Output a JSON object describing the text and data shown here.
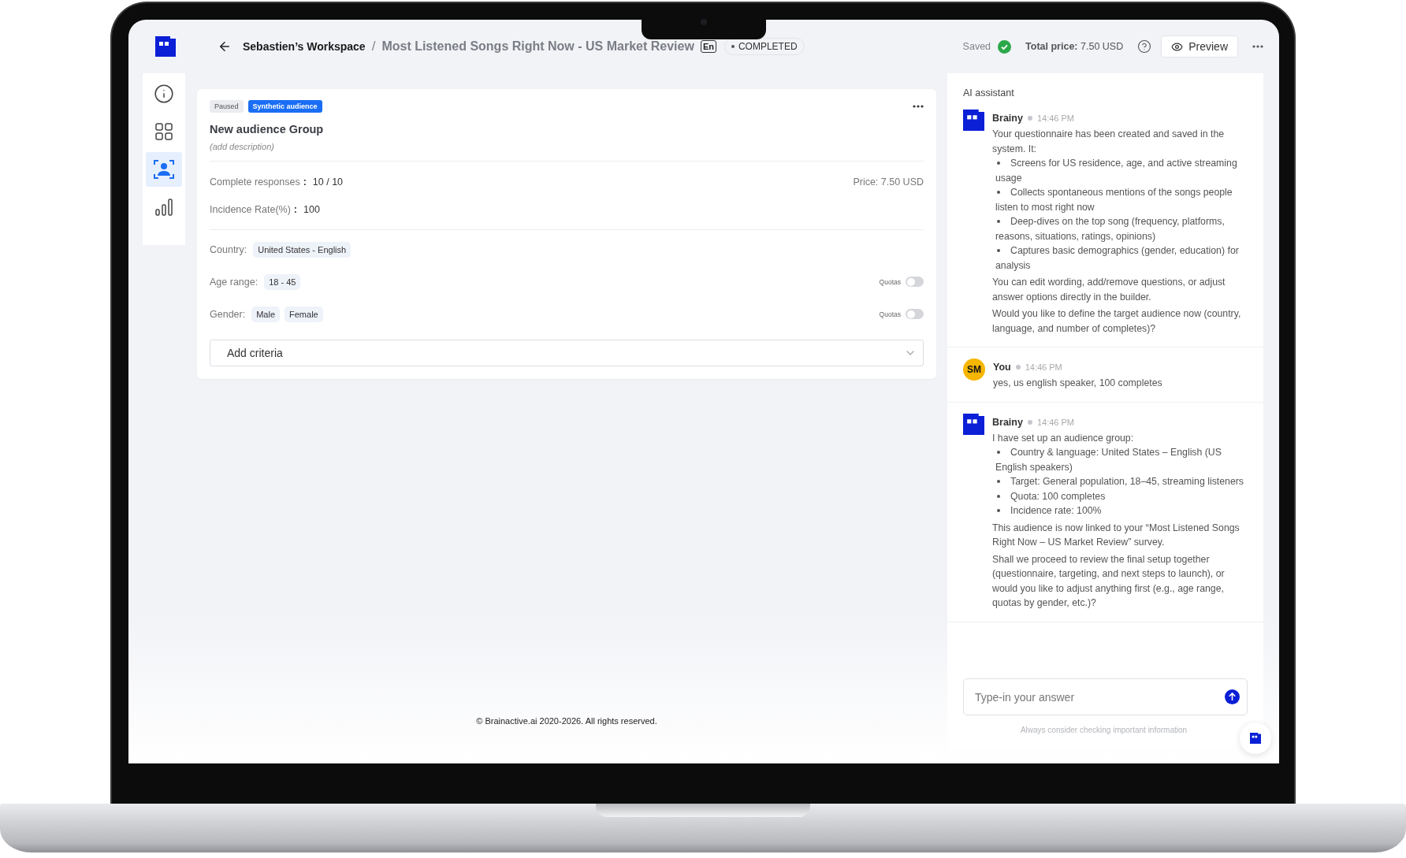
{
  "header": {
    "workspace": "Sebastien’s Workspace",
    "separator": "/",
    "title": "Most Listened Songs Right Now - US Market Review",
    "language": "En",
    "status": "COMPLETED",
    "saved": "Saved",
    "total_price_label": "Total price:",
    "total_price": "7.50 USD",
    "preview": "Preview"
  },
  "sidebar": {
    "items": [
      {
        "selected": false
      },
      {
        "selected": false
      },
      {
        "selected": true
      },
      {
        "selected": false
      }
    ]
  },
  "audience": {
    "tags": [
      {
        "label": "Paused",
        "kind": "neutral"
      },
      {
        "label": "Synthetic audience",
        "kind": "primary"
      }
    ],
    "name": "New audience Group",
    "description": "(add description)",
    "stats": [
      {
        "label": "Complete responses",
        "sep": ":",
        "value": "10 / 10"
      },
      {
        "label": "Incidence Rate(%)",
        "sep": ":",
        "value": "100"
      }
    ],
    "price": "Price: 7.50 USD",
    "criteria": [
      {
        "label": "Country:",
        "chips": [
          "United States - English"
        ]
      },
      {
        "label": "Age range:",
        "chips": [
          "18 - 45"
        ],
        "quotas": {
          "label": "Quotas",
          "on": false
        }
      },
      {
        "label": "Gender:",
        "chips": [
          "Male",
          "Female"
        ],
        "quotas": {
          "label": "Quotas",
          "on": false
        }
      }
    ],
    "add_criteria": "Add criteria"
  },
  "assistant": {
    "title": "AI assistant",
    "messages": [
      {
        "author": "Brainy",
        "kind": "bot",
        "time": "14:46 PM",
        "blocks": [
          {
            "kind": "text",
            "text": "Your questionnaire has been created and saved in the system. It:"
          },
          {
            "kind": "bullet",
            "text": "Screens for US residence, age, and active streaming usage"
          },
          {
            "kind": "bullet",
            "text": "Collects spontaneous mentions of the songs people listen to most right now"
          },
          {
            "kind": "bullet",
            "text": "Deep-dives on the top song (frequency, platforms, reasons, situations, ratings, opinions)"
          },
          {
            "kind": "bullet",
            "text": "Captures basic demographics (gender, education) for analysis"
          },
          {
            "kind": "text",
            "text": "You can edit wording, add/remove questions, or adjust answer options directly in the builder."
          },
          {
            "kind": "text",
            "text": "Would you like to define the target audience now (country, language, and number of completes)?"
          }
        ]
      },
      {
        "author": "You",
        "kind": "user",
        "initials": "SM",
        "time": "14:46 PM",
        "blocks": [
          {
            "kind": "text",
            "text": "yes, us english speaker, 100 completes"
          }
        ]
      },
      {
        "author": "Brainy",
        "kind": "bot",
        "time": "14:46 PM",
        "blocks": [
          {
            "kind": "text",
            "text": "I have set up an audience group:"
          },
          {
            "kind": "bullet",
            "text": "Country & language: United States – English (US English speakers)"
          },
          {
            "kind": "bullet",
            "text": "Target: General population, 18–45, streaming listeners"
          },
          {
            "kind": "bullet",
            "text": "Quota: 100 completes"
          },
          {
            "kind": "bullet",
            "text": "Incidence rate: 100%"
          },
          {
            "kind": "text",
            "text": "This audience is now linked to your “Most Listened Songs Right Now – US Market Review” survey."
          },
          {
            "kind": "text",
            "text": "Shall we proceed to review the final setup together (questionnaire, targeting, and next steps to launch), or would you like to adjust anything first (e.g., age range, quotas by gender, etc.)?"
          }
        ]
      }
    ],
    "input": {
      "placeholder": "Type-in your answer"
    },
    "disclaimer": "Always consider checking important information"
  },
  "footer": "© Brainactive.ai 2020-2026. All rights reserved."
}
